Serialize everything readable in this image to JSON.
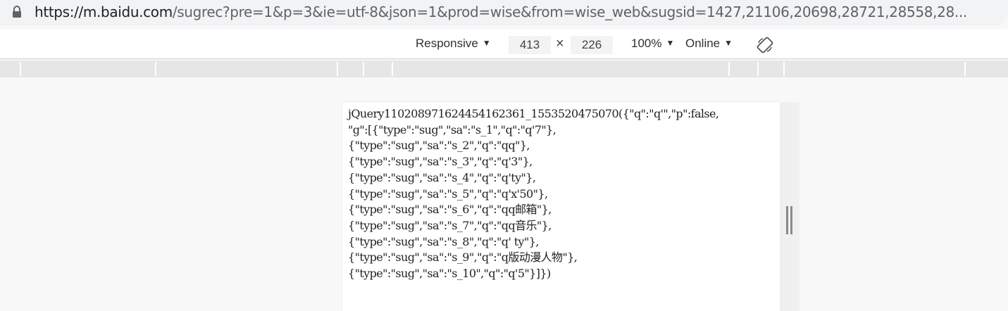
{
  "address_bar": {
    "host": "https://m.baidu.com",
    "rest": "/sugrec?pre=1&p=3&ie=utf-8&json=1&prod=wise&from=wise_web&sugsid=1427,21106,20698,28721,28558,28..."
  },
  "device_toolbar": {
    "device_label": "Responsive",
    "width_value": "413",
    "times_symbol": "×",
    "height_value": "226",
    "zoom_label": "100%",
    "network_label": "Online",
    "dropdown_arrow": "▼"
  },
  "response": {
    "lines": [
      "jQuery110208971624454162361_1553520475070({\"q\":\"q'\",\"p\":false,",
      "\"g\":[{\"type\":\"sug\",\"sa\":\"s_1\",\"q\":\"q'7\"},",
      "{\"type\":\"sug\",\"sa\":\"s_2\",\"q\":\"qq\"},",
      "{\"type\":\"sug\",\"sa\":\"s_3\",\"q\":\"q'3\"},",
      "{\"type\":\"sug\",\"sa\":\"s_4\",\"q\":\"q'ty\"},",
      "{\"type\":\"sug\",\"sa\":\"s_5\",\"q\":\"q'x'50\"},",
      "{\"type\":\"sug\",\"sa\":\"s_6\",\"q\":\"qq邮箱\"},",
      "{\"type\":\"sug\",\"sa\":\"s_7\",\"q\":\"qq音乐\"},",
      "{\"type\":\"sug\",\"sa\":\"s_8\",\"q\":\"q' ty\"},",
      "{\"type\":\"sug\",\"sa\":\"s_9\",\"q\":\"q版动漫人物\"},",
      "{\"type\":\"sug\",\"sa\":\"s_10\",\"q\":\"q'5\"}]})"
    ]
  },
  "icons": {
    "lock": "lock-icon",
    "rotate": "rotate-icon",
    "resize": "resize-handle-icon"
  }
}
